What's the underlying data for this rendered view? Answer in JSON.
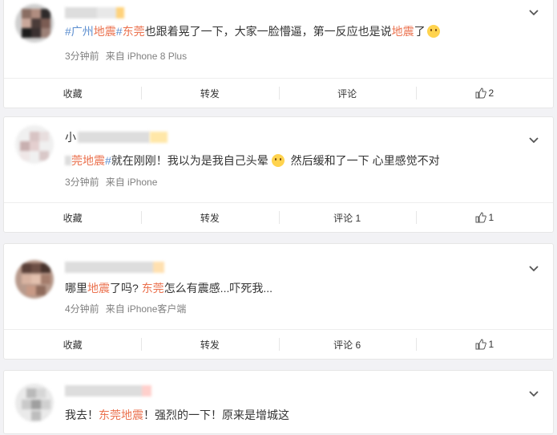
{
  "posts": [
    {
      "name_text": "",
      "content": [
        {
          "t": "tag",
          "v": "#广州"
        },
        {
          "t": "hl",
          "v": "地震"
        },
        {
          "t": "tag",
          "v": "#"
        },
        {
          "t": "hl",
          "v": "东莞"
        },
        {
          "t": "txt",
          "v": "也跟着晃了一下，大家一脸懵逼，第一反应也是说"
        },
        {
          "t": "hl",
          "v": "地震"
        },
        {
          "t": "txt",
          "v": "了"
        }
      ],
      "has_emoji": true,
      "time": "3分钟前",
      "source": "来自 iPhone 8 Plus",
      "actions": {
        "favorite": "收藏",
        "repost": "转发",
        "comment": "评论",
        "like": "2"
      }
    },
    {
      "name_text": "小",
      "content": [
        {
          "t": "hl",
          "v": "莞地震"
        },
        {
          "t": "tag",
          "v": "#"
        },
        {
          "t": "txt",
          "v": "就在刚刚！我以为是我自己头晕"
        },
        {
          "t": "emoji",
          "v": ""
        },
        {
          "t": "txt",
          "v": " 然后缓和了一下 心里感觉不对"
        }
      ],
      "has_emoji": false,
      "time": "3分钟前",
      "source": "来自 iPhone",
      "actions": {
        "favorite": "收藏",
        "repost": "转发",
        "comment": "评论 1",
        "like": "1"
      }
    },
    {
      "name_text": "",
      "content": [
        {
          "t": "txt",
          "v": "哪里"
        },
        {
          "t": "hl",
          "v": "地震"
        },
        {
          "t": "txt",
          "v": "了吗? "
        },
        {
          "t": "hl",
          "v": "东莞"
        },
        {
          "t": "txt",
          "v": "怎么有震感...吓死我..."
        }
      ],
      "has_emoji": false,
      "time": "4分钟前",
      "source": "来自 iPhone客户端",
      "actions": {
        "favorite": "收藏",
        "repost": "转发",
        "comment": "评论 6",
        "like": "1"
      }
    },
    {
      "name_text": "",
      "content": [
        {
          "t": "txt",
          "v": "我去！"
        },
        {
          "t": "hl",
          "v": "东莞地震"
        },
        {
          "t": "txt",
          "v": "！强烈的一下！原来是增城这"
        }
      ],
      "has_emoji": false,
      "time": "",
      "source": "",
      "actions": null
    }
  ],
  "icons": {
    "chevron": "chevron-down-icon",
    "like": "thumbs-up-icon",
    "emoji": "smile-emoji-icon"
  }
}
